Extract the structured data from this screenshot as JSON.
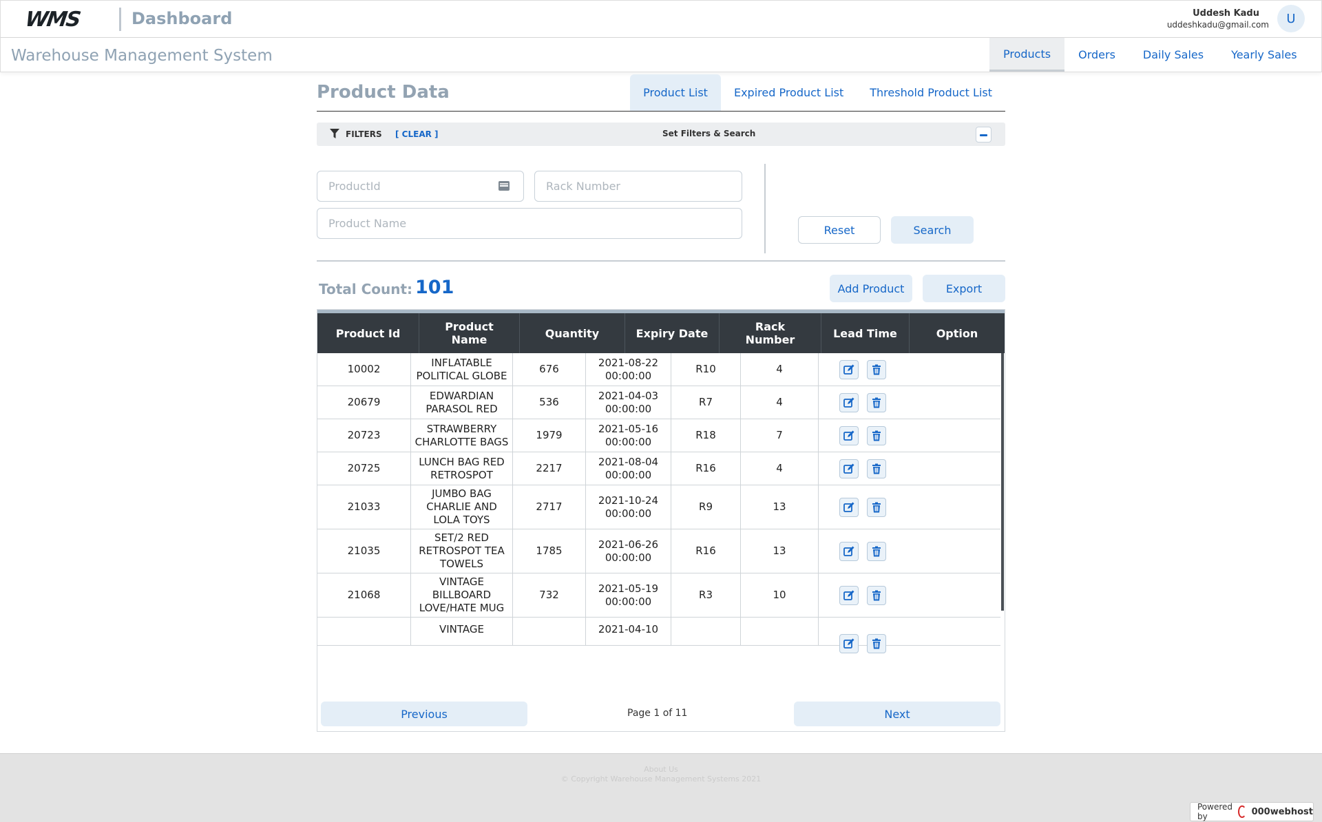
{
  "header": {
    "logo_text": "WMS",
    "title": "Dashboard",
    "user_name": "Uddesh Kadu",
    "user_email": "uddeshkadu@gmail.com",
    "avatar_initial": "U"
  },
  "nav": {
    "system_title": "Warehouse Management System",
    "tabs": [
      "Products",
      "Orders",
      "Daily Sales",
      "Yearly Sales"
    ],
    "active_tab": "Products"
  },
  "page": {
    "title": "Product Data",
    "sub_tabs": [
      "Product List",
      "Expired Product List",
      "Threshold Product List"
    ],
    "active_sub_tab": "Product List"
  },
  "filters": {
    "label": "FILTERS",
    "clear_label": "[ CLEAR ]",
    "center_label": "Set Filters & Search",
    "product_id_placeholder": "ProductId",
    "rack_number_placeholder": "Rack Number",
    "product_name_placeholder": "Product Name",
    "reset_label": "Reset",
    "search_label": "Search"
  },
  "summary": {
    "count_label": "Total Count:",
    "count_value": "101",
    "add_label": "Add Product",
    "export_label": "Export"
  },
  "table": {
    "headers": [
      "Product Id",
      "Product Name",
      "Quantity",
      "Expiry Date",
      "Rack Number",
      "Lead Time",
      "Option"
    ],
    "rows": [
      {
        "id": "10002",
        "name": "INFLATABLE POLITICAL GLOBE",
        "qty": "676",
        "expiry": "2021-08-22 00:00:00",
        "rack": "R10",
        "lead": "4"
      },
      {
        "id": "20679",
        "name": "EDWARDIAN PARASOL RED",
        "qty": "536",
        "expiry": "2021-04-03 00:00:00",
        "rack": "R7",
        "lead": "4"
      },
      {
        "id": "20723",
        "name": "STRAWBERRY CHARLOTTE BAGS",
        "qty": "1979",
        "expiry": "2021-05-16 00:00:00",
        "rack": "R18",
        "lead": "7"
      },
      {
        "id": "20725",
        "name": "LUNCH BAG RED RETROSPOT",
        "qty": "2217",
        "expiry": "2021-08-04 00:00:00",
        "rack": "R16",
        "lead": "4"
      },
      {
        "id": "21033",
        "name": "JUMBO BAG CHARLIE AND LOLA TOYS",
        "qty": "2717",
        "expiry": "2021-10-24 00:00:00",
        "rack": "R9",
        "lead": "13"
      },
      {
        "id": "21035",
        "name": "SET/2 RED RETROSPOT TEA TOWELS",
        "qty": "1785",
        "expiry": "2021-06-26 00:00:00",
        "rack": "R16",
        "lead": "13"
      },
      {
        "id": "21068",
        "name": "VINTAGE BILLBOARD LOVE/HATE MUG",
        "qty": "732",
        "expiry": "2021-05-19 00:00:00",
        "rack": "R3",
        "lead": "10"
      },
      {
        "id": "",
        "name": "VINTAGE",
        "qty": "",
        "expiry": "2021-04-10",
        "rack": "",
        "lead": ""
      }
    ]
  },
  "pager": {
    "prev_label": "Previous",
    "next_label": "Next",
    "page_info": "Page 1 of 11"
  },
  "footer": {
    "about": "About Us",
    "copyright": "© Copyright Warehouse Management Systems 2021",
    "powered_by": "Powered by",
    "host_name": "000webhost"
  },
  "colors": {
    "accent": "#1667c8",
    "table_header": "#343a40",
    "muted_title": "#93a3b2",
    "button_fill": "#e4eef7"
  }
}
